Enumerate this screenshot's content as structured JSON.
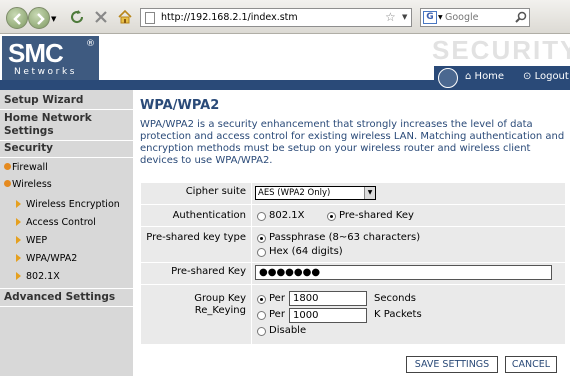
{
  "browser": {
    "url": "http://192.168.2.1/index.stm",
    "search_placeholder": "Google"
  },
  "header": {
    "logo_text": "SMC",
    "logo_reg": "®",
    "logo_sub": "Networks",
    "section_title": "SECURITY",
    "home_label": "Home",
    "logout_label": "Logout"
  },
  "sidebar": {
    "setup_wizard": "Setup Wizard",
    "home_network_settings": "Home Network Settings",
    "security": "Security",
    "firewall": "Firewall",
    "wireless": "Wireless",
    "wireless_encryption": "Wireless Encryption",
    "access_control": "Access Control",
    "wep": "WEP",
    "wpa_wpa2": "WPA/WPA2",
    "dot1x": "802.1X",
    "advanced_settings": "Advanced Settings"
  },
  "page": {
    "title": "WPA/WPA2",
    "description": "WPA/WPA2 is a security enhancement that strongly increases the level of data protection and access control for existing wireless LAN. Matching authentication and encryption methods must be setup on your wireless router and wireless client devices to use WPA/WPA2."
  },
  "form": {
    "cipher_label": "Cipher suite",
    "cipher_value": "AES (WPA2 Only)",
    "auth_label": "Authentication",
    "auth_opt1": "802.1X",
    "auth_opt2": "Pre-shared Key",
    "psk_type_label": "Pre-shared key type",
    "psk_type_opt1": "Passphrase (8~63 characters)",
    "psk_type_opt2": "Hex (64 digits)",
    "psk_label": "Pre-shared Key",
    "psk_value": "●●●●●●●",
    "rekey_label1": "Group Key",
    "rekey_label2": "Re_Keying",
    "per1": "Per",
    "per1_value": "1800",
    "per1_unit": "Seconds",
    "per2": "Per",
    "per2_value": "1000",
    "per2_unit": "K Packets",
    "disable": "Disable"
  },
  "buttons": {
    "save": "SAVE SETTINGS",
    "cancel": "CANCEL"
  }
}
